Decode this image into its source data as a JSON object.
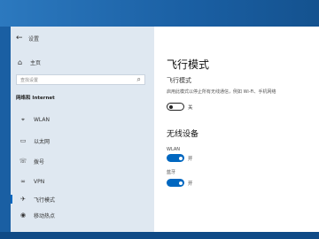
{
  "window": {
    "title": "设置"
  },
  "sidebar": {
    "home_label": "主页",
    "search_placeholder": "查找设置",
    "section_title": "网络和 Internet",
    "items": [
      {
        "icon": "globe-icon",
        "label": "WLAN"
      },
      {
        "icon": "ethernet-icon",
        "label": "以太网"
      },
      {
        "icon": "phone-icon",
        "label": "拨号"
      },
      {
        "icon": "vpn-icon",
        "label": "VPN"
      },
      {
        "icon": "airplane-icon",
        "label": "飞行模式",
        "active": true
      },
      {
        "icon": "hotspot-icon",
        "label": "移动热点"
      }
    ]
  },
  "content": {
    "title": "飞行模式",
    "airplane": {
      "subtitle": "飞行模式",
      "description": "启用此模式以停止所有无线通信，例如 Wi-Fi、手机网络",
      "toggle_state": "关"
    },
    "wireless": {
      "heading": "无线设备",
      "wlan_label": "WLAN",
      "wlan_state": "开",
      "bt_label": "蓝牙",
      "bt_state": "开"
    }
  },
  "colors": {
    "accent": "#0067c0",
    "sidebar_bg": "#dfe8f1",
    "desktop": "#1d6ab0"
  }
}
